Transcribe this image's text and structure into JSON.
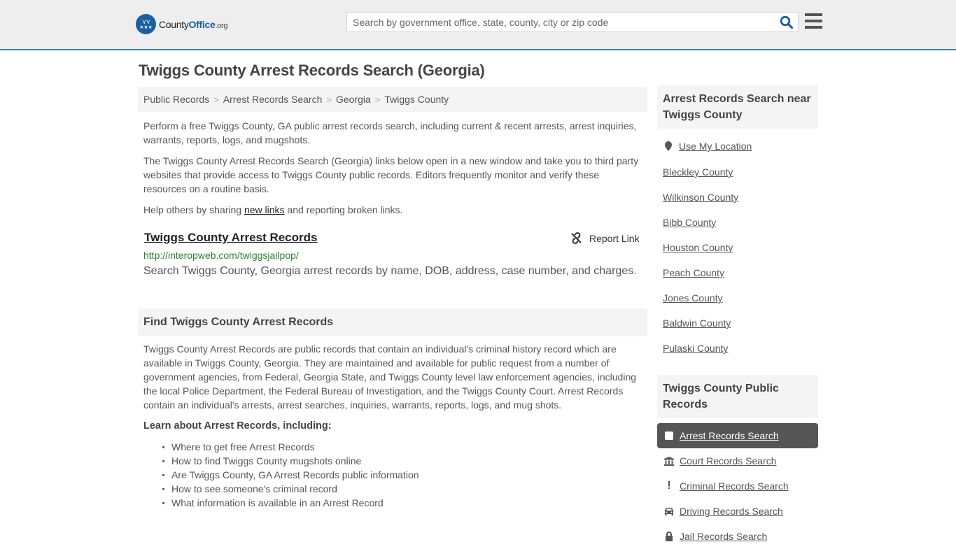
{
  "header": {
    "logo": {
      "name_a": "County",
      "name_b": "Office",
      "name_c": ".org",
      "icon": "eagle-stars-badge-icon"
    },
    "search": {
      "placeholder": "Search by government office, state, county, city or zip code",
      "value": "",
      "icon": "search-icon"
    },
    "menu_icon": "hamburger-menu-icon",
    "accent_color": "#3a7eb0"
  },
  "page": {
    "title": "Twiggs County Arrest Records Search (Georgia)",
    "breadcrumb": [
      "Public Records",
      "Arrest Records Search",
      "Georgia",
      "Twiggs County"
    ],
    "intro": "Perform a free Twiggs County, GA public arrest records search, including current & recent arrests, arrest inquiries, warrants, reports, logs, and mugshots.",
    "disclaimer": "The Twiggs County Arrest Records Search (Georgia) links below open in a new window and take you to third party websites that provide access to Twiggs County public records. Editors frequently monitor and verify these resources on a routine basis.",
    "help_prefix": "Help others by sharing ",
    "help_link": "new links",
    "help_suffix": " and reporting broken links."
  },
  "result": {
    "title": "Twiggs County Arrest Records",
    "report_label": "Report Link",
    "report_icon": "broken-link-icon",
    "url": "http://interopweb.com/twiggsjailpop/",
    "description": "Search Twiggs County, Georgia arrest records by name, DOB, address, case number, and charges."
  },
  "find_section": {
    "heading": "Find Twiggs County Arrest Records",
    "body": "Twiggs County Arrest Records are public records that contain an individual's criminal history record which are available in Twiggs County, Georgia. They are maintained and available for public request from a number of government agencies, from Federal, Georgia State, and Twiggs County level law enforcement agencies, including the local Police Department, the Federal Bureau of Investigation, and the Twiggs County Court. Arrest Records contain an individual's arrests, arrest searches, inquiries, warrants, reports, logs, and mug shots.",
    "learn_heading": "Learn about Arrest Records, including:",
    "learn_items": [
      "Where to get free Arrest Records",
      "How to find Twiggs County mugshots online",
      "Are Twiggs County, GA Arrest Records public information",
      "How to see someone's criminal record",
      "What information is available in an Arrest Record"
    ]
  },
  "sidebar": {
    "nearby_heading": "Arrest Records Search near Twiggs County",
    "use_location": "Use My Location",
    "location_icon": "map-pin-icon",
    "nearby": [
      "Bleckley County",
      "Wilkinson County",
      "Bibb County",
      "Houston County",
      "Peach County",
      "Jones County",
      "Baldwin County",
      "Pulaski County"
    ],
    "public_records_heading": "Twiggs County Public Records",
    "records": [
      {
        "label": "Arrest Records Search",
        "icon": "square-icon",
        "active": true
      },
      {
        "label": "Court Records Search",
        "icon": "courthouse-icon",
        "active": false
      },
      {
        "label": "Criminal Records Search",
        "icon": "exclamation-icon",
        "active": false
      },
      {
        "label": "Driving Records Search",
        "icon": "car-icon",
        "active": false
      },
      {
        "label": "Jail Records Search",
        "icon": "lock-icon",
        "active": false
      }
    ]
  }
}
